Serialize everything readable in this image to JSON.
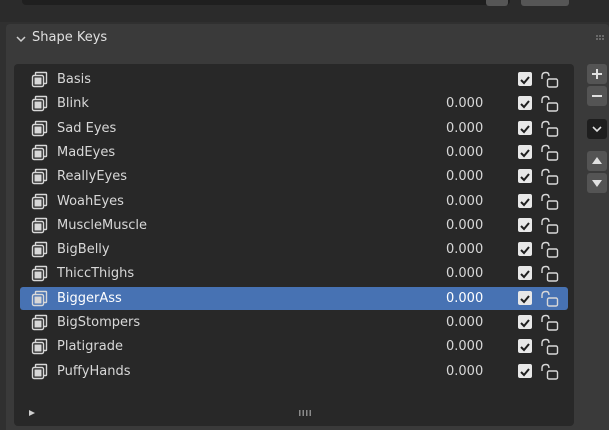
{
  "panel": {
    "title": "Shape Keys"
  },
  "shape_keys": [
    {
      "name": "Basis",
      "value": "",
      "enabled": true,
      "locked": false,
      "selected": false
    },
    {
      "name": "Blink",
      "value": "0.000",
      "enabled": true,
      "locked": false,
      "selected": false
    },
    {
      "name": "Sad Eyes",
      "value": "0.000",
      "enabled": true,
      "locked": false,
      "selected": false
    },
    {
      "name": "MadEyes",
      "value": "0.000",
      "enabled": true,
      "locked": false,
      "selected": false
    },
    {
      "name": "ReallyEyes",
      "value": "0.000",
      "enabled": true,
      "locked": false,
      "selected": false
    },
    {
      "name": "WoahEyes",
      "value": "0.000",
      "enabled": true,
      "locked": false,
      "selected": false
    },
    {
      "name": "MuscleMuscle",
      "value": "0.000",
      "enabled": true,
      "locked": false,
      "selected": false
    },
    {
      "name": "BigBelly",
      "value": "0.000",
      "enabled": true,
      "locked": false,
      "selected": false
    },
    {
      "name": "ThiccThighs",
      "value": "0.000",
      "enabled": true,
      "locked": false,
      "selected": false
    },
    {
      "name": "BiggerAss",
      "value": "0.000",
      "enabled": true,
      "locked": false,
      "selected": true
    },
    {
      "name": "BigStompers",
      "value": "0.000",
      "enabled": true,
      "locked": false,
      "selected": false
    },
    {
      "name": "Platigrade",
      "value": "0.000",
      "enabled": true,
      "locked": false,
      "selected": false
    },
    {
      "name": "PuffyHands",
      "value": "0.000",
      "enabled": true,
      "locked": false,
      "selected": false
    }
  ],
  "side_buttons": [
    {
      "icon": "plus-icon"
    },
    {
      "icon": "minus-icon"
    },
    {
      "icon": "chevron-down-icon"
    },
    {
      "icon": "arrow-up-icon"
    },
    {
      "icon": "arrow-down-icon"
    }
  ],
  "colors": {
    "selection": "#4772b3",
    "list_bg": "#282828",
    "panel_bg": "#3a3a3a"
  }
}
